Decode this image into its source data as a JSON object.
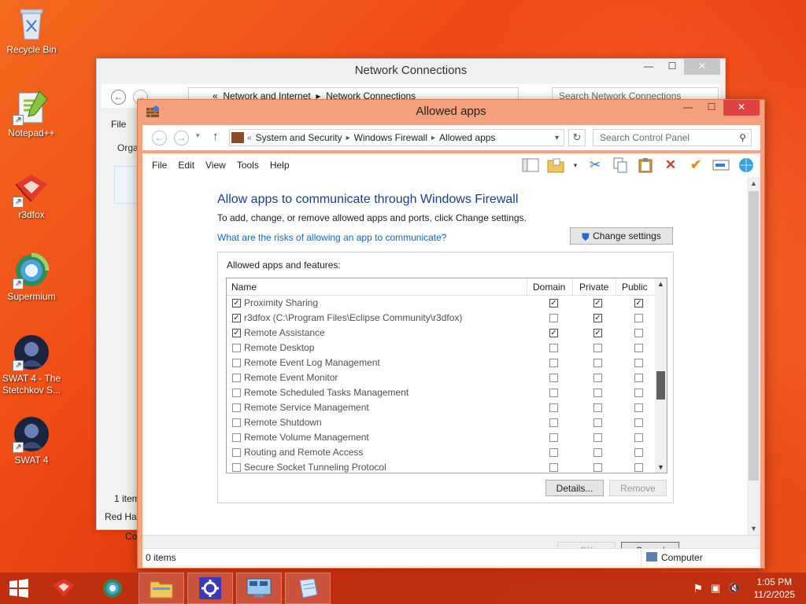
{
  "desktop": {
    "icons": [
      {
        "label": "Recycle Bin"
      },
      {
        "label": "Notepad++"
      },
      {
        "label": "r3dfox"
      },
      {
        "label": "Supermium"
      },
      {
        "label": "SWAT 4 - The Stetchkov S..."
      },
      {
        "label": "SWAT 4"
      }
    ]
  },
  "bg_window": {
    "title": "Network Connections",
    "breadcrumb": [
      "Network and Internet",
      "Network Connections"
    ],
    "search_placeholder": "Search Network Connections",
    "menu_first": "File",
    "organize": "Orga",
    "item_count": "1 item",
    "bottom_left": "Red Hat",
    "bottom_left2": "Co"
  },
  "window": {
    "title": "Allowed apps",
    "breadcrumb": [
      "System and Security",
      "Windows Firewall",
      "Allowed apps"
    ],
    "search_placeholder": "Search Control Panel",
    "menu": [
      "File",
      "Edit",
      "View",
      "Tools",
      "Help"
    ],
    "heading": "Allow apps to communicate through Windows Firewall",
    "subtext": "To add, change, or remove allowed apps and ports, click Change settings.",
    "link": "What are the risks of allowing an app to communicate?",
    "change_settings": "Change settings",
    "group_label": "Allowed apps and features:",
    "columns": {
      "name": "Name",
      "domain": "Domain",
      "private": "Private",
      "public": "Public"
    },
    "rows": [
      {
        "name": "Proximity Sharing",
        "enabled": true,
        "domain": true,
        "private": true,
        "public": true
      },
      {
        "name": "r3dfox (C:\\Program Files\\Eclipse Community\\r3dfox)",
        "enabled": true,
        "domain": false,
        "private": true,
        "public": false
      },
      {
        "name": "Remote Assistance",
        "enabled": true,
        "domain": true,
        "private": true,
        "public": false
      },
      {
        "name": "Remote Desktop",
        "enabled": false,
        "domain": false,
        "private": false,
        "public": false
      },
      {
        "name": "Remote Event Log Management",
        "enabled": false,
        "domain": false,
        "private": false,
        "public": false
      },
      {
        "name": "Remote Event Monitor",
        "enabled": false,
        "domain": false,
        "private": false,
        "public": false
      },
      {
        "name": "Remote Scheduled Tasks Management",
        "enabled": false,
        "domain": false,
        "private": false,
        "public": false
      },
      {
        "name": "Remote Service Management",
        "enabled": false,
        "domain": false,
        "private": false,
        "public": false
      },
      {
        "name": "Remote Shutdown",
        "enabled": false,
        "domain": false,
        "private": false,
        "public": false
      },
      {
        "name": "Remote Volume Management",
        "enabled": false,
        "domain": false,
        "private": false,
        "public": false
      },
      {
        "name": "Routing and Remote Access",
        "enabled": false,
        "domain": false,
        "private": false,
        "public": false
      },
      {
        "name": "Secure Socket Tunneling Protocol",
        "enabled": false,
        "domain": false,
        "private": false,
        "public": false
      }
    ],
    "details": "Details...",
    "remove": "Remove",
    "ok": "OK",
    "cancel": "Cancel",
    "status_items": "0 items",
    "status_zone": "Computer"
  },
  "taskbar": {
    "time": "1:05 PM",
    "date": "11/2/2025"
  },
  "colors": {
    "accent_heading": "#1a3e8c",
    "link": "#1565c0",
    "window_frame": "#f6a07d",
    "close_button": "#e04343"
  }
}
